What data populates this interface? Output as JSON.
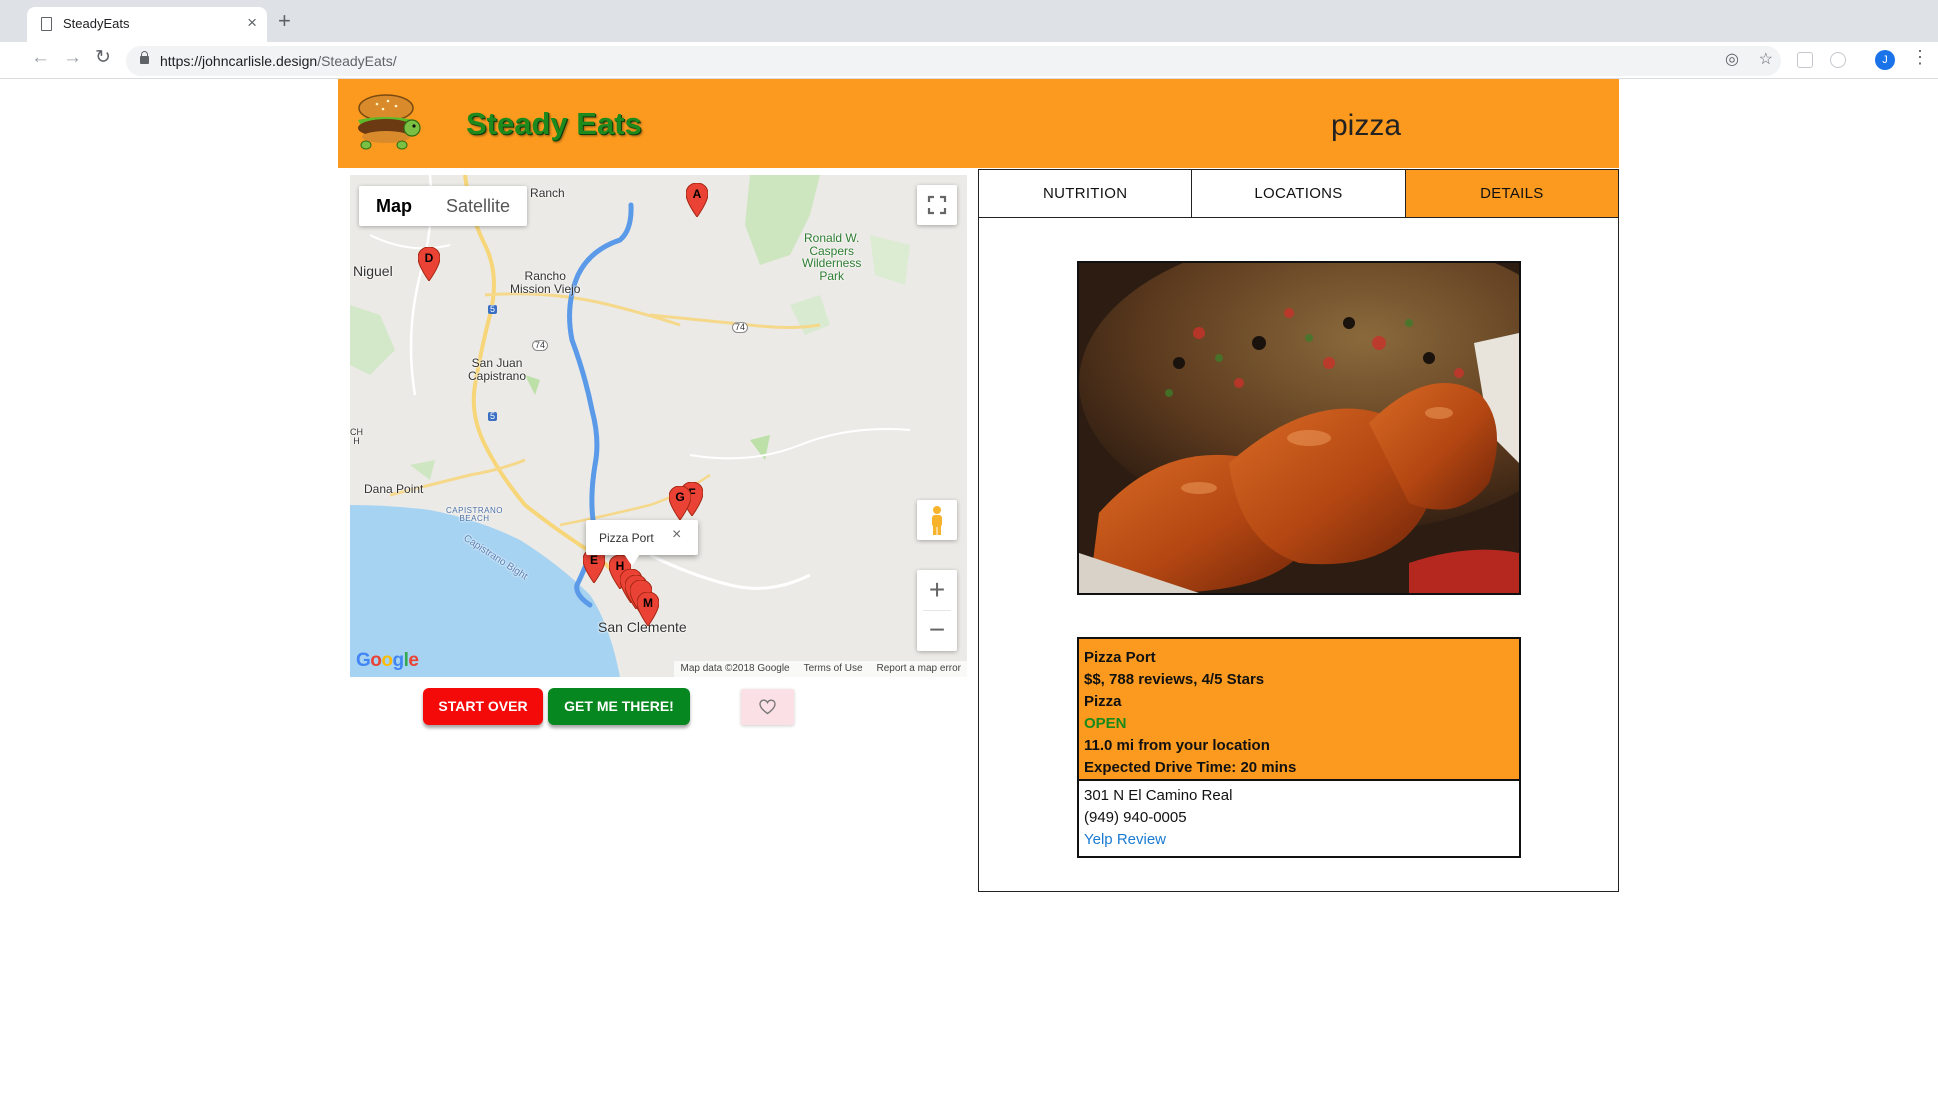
{
  "browser": {
    "tab_title": "SteadyEats",
    "url_host": "https://johncarlisle.design",
    "url_path": "/SteadyEats/",
    "avatar_initial": "J"
  },
  "header": {
    "app_title": "Steady Eats",
    "search_term": "pizza"
  },
  "map": {
    "type_options": [
      "Map",
      "Satellite"
    ],
    "selected_type": "Map",
    "labels": {
      "ladera_ranch": "adera Ranch",
      "niguel": "Niguel",
      "rancho_mission_viejo": "Rancho\nMission Viejo",
      "ronald_caspers": "Ronald W.\nCaspers\nWilderness\nPark",
      "san_juan_capistrano": "San Juan\nCapistrano",
      "dana_point": "Dana Point",
      "capistrano_beach": "CAPISTRANO\nBEACH",
      "capistrano_bight": "Capistrano Bight",
      "san_clemente": "San Clemente",
      "edge_ch": "CH\nH",
      "hwy_74_a": "74",
      "hwy_74_b": "74",
      "hwy_5_a": "5",
      "hwy_5_b": "5"
    },
    "markers": [
      "A",
      "D",
      "G",
      "F",
      "E",
      "H",
      "M"
    ],
    "info_window": {
      "title": "Pizza Port",
      "close": "×"
    },
    "google_logo": [
      "G",
      "o",
      "o",
      "g",
      "l",
      "e"
    ],
    "footer": {
      "map_data": "Map data ©2018 Google",
      "terms": "Terms of Use",
      "report": "Report a map error"
    },
    "zoom_in": "+",
    "zoom_out": "−"
  },
  "actions": {
    "start_over": "START OVER",
    "get_me_there": "GET ME THERE!"
  },
  "panel": {
    "tabs": [
      {
        "label": "NUTRITION",
        "active": false
      },
      {
        "label": "LOCATIONS",
        "active": false
      },
      {
        "label": "DETAILS",
        "active": true
      }
    ],
    "details": {
      "name": "Pizza Port",
      "summary": "$$, 788 reviews, 4/5 Stars",
      "category": "Pizza",
      "status": "OPEN",
      "distance": "11.0 mi from your location",
      "drive_time": "Expected Drive Time: 20 mins",
      "address": "301 N El Camino Real",
      "phone": "(949) 940-0005",
      "yelp_link": "Yelp Review"
    }
  },
  "colors": {
    "accent_orange": "#fb9a1e",
    "title_green": "#1e8a1e",
    "start_over_red": "#f50a0a",
    "get_me_there_green": "#07871f",
    "open_green": "#1a8a1a",
    "link_blue": "#1a7bd1",
    "marker_red": "#ea4335"
  }
}
